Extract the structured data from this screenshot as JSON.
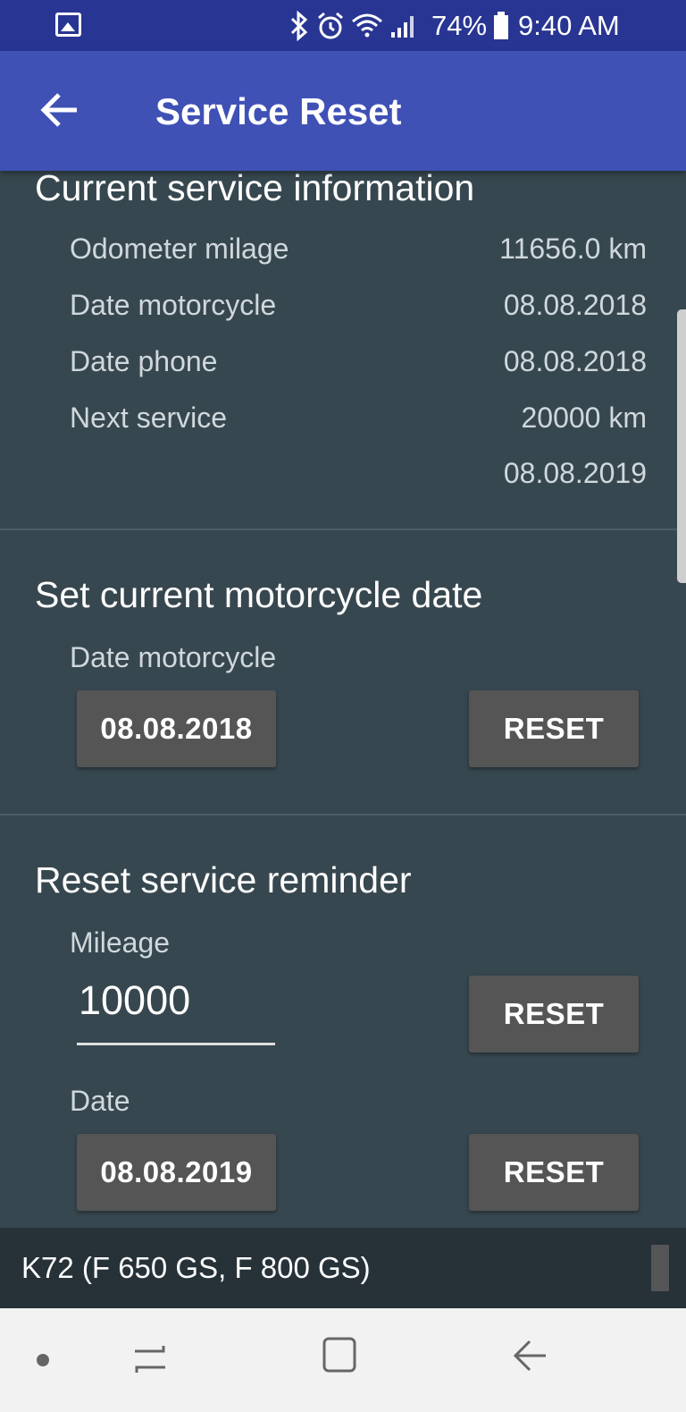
{
  "status_bar": {
    "battery": "74%",
    "time": "9:40 AM",
    "icons": [
      "image-icon",
      "bluetooth-icon",
      "alarm-icon",
      "wifi-icon",
      "signal-icon",
      "battery-icon"
    ]
  },
  "app_bar": {
    "title": "Service Reset"
  },
  "current_info": {
    "title": "Current service information",
    "rows": [
      {
        "label": "Odometer milage",
        "value": "11656.0 km"
      },
      {
        "label": "Date motorcycle",
        "value": "08.08.2018"
      },
      {
        "label": "Date phone",
        "value": "08.08.2018"
      },
      {
        "label": "Next service",
        "value": "20000 km"
      },
      {
        "label": "",
        "value": "08.08.2019"
      }
    ]
  },
  "set_date": {
    "title": "Set current motorcycle date",
    "label": "Date motorcycle",
    "date_value": "08.08.2018",
    "reset_label": "RESET"
  },
  "reminder": {
    "title": "Reset service reminder",
    "mileage_label": "Mileage",
    "mileage_value": "10000",
    "mileage_reset_label": "RESET",
    "date_label": "Date",
    "date_value": "08.08.2019",
    "date_reset_label": "RESET"
  },
  "footer": {
    "model": "K72 (F 650 GS, F 800 GS)"
  },
  "colors": {
    "status_bar": "#283593",
    "app_bar": "#3f51b5",
    "background": "#37474f",
    "footer": "#263238",
    "button": "#555555"
  }
}
